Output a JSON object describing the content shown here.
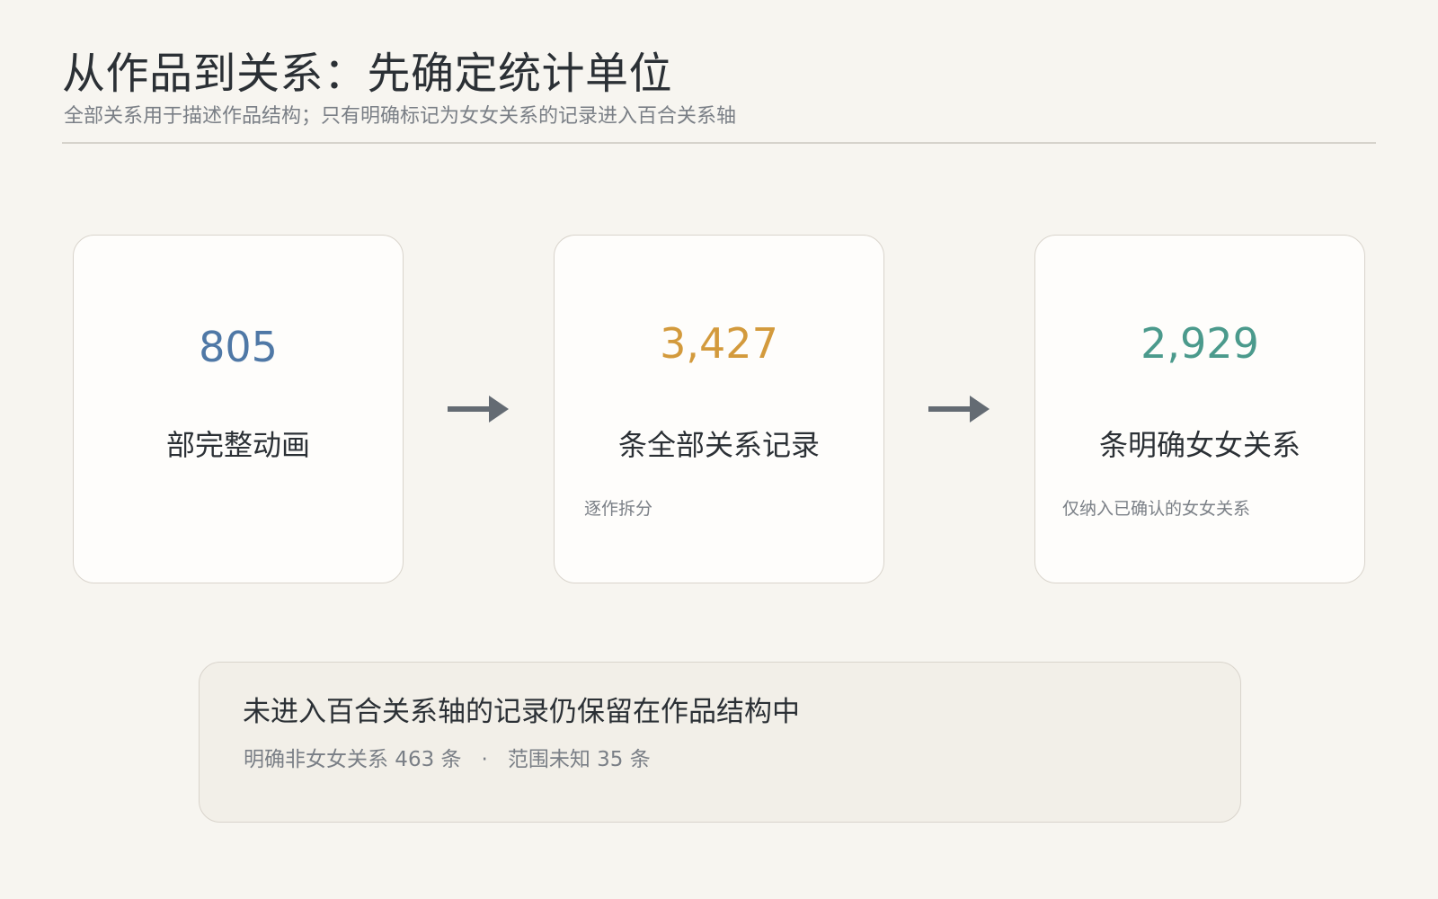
{
  "header": {
    "title": "从作品到关系：先确定统计单位",
    "subtitle": "全部关系用于描述作品结构；只有明确标记为女女关系的记录进入百合关系轴"
  },
  "flow": {
    "cards": [
      {
        "value": "805",
        "label": "部完整动画",
        "note": "",
        "color": "#4f78a6"
      },
      {
        "value": "3,427",
        "label": "条全部关系记录",
        "note": "逐作拆分",
        "color": "#d39a3c"
      },
      {
        "value": "2,929",
        "label": "条明确女女关系",
        "note": "仅纳入已确认的女女关系",
        "color": "#4b9a8c"
      }
    ],
    "arrow_icon": "arrow-right-icon",
    "arrow_color": "#646b73"
  },
  "footer": {
    "title": "未进入百合关系轴的记录仍保留在作品结构中",
    "detail_a": "明确非女女关系 463 条",
    "separator": "·",
    "detail_b": "范围未知 35 条"
  }
}
